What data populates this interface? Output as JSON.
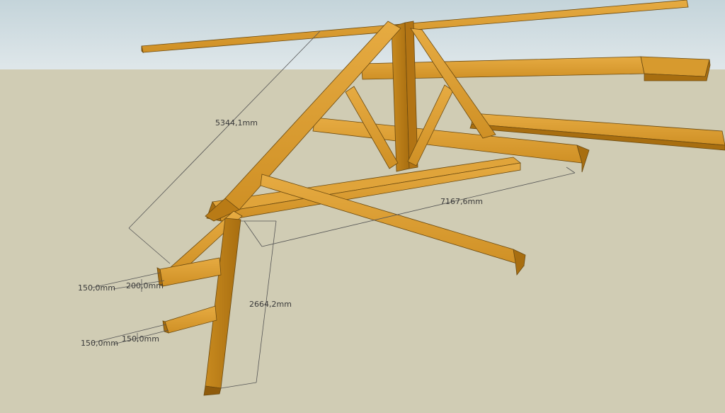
{
  "scene": {
    "sky_color": "#c9d7dd",
    "ground_color": "#d0ccb4",
    "wood_top": "#e2a53a",
    "wood_side": "#b97b16",
    "wood_dark": "#8f5b0c",
    "line_color": "#555555"
  },
  "dimensions": {
    "rafter_length": "5344,1mm",
    "span_length": "7167,6mm",
    "post_height": "2664,2mm",
    "upper_bracket_width": "150,0mm",
    "upper_bracket_height": "200,0mm",
    "lower_bracket_width": "150,0mm",
    "lower_bracket_height": "150,0mm"
  }
}
